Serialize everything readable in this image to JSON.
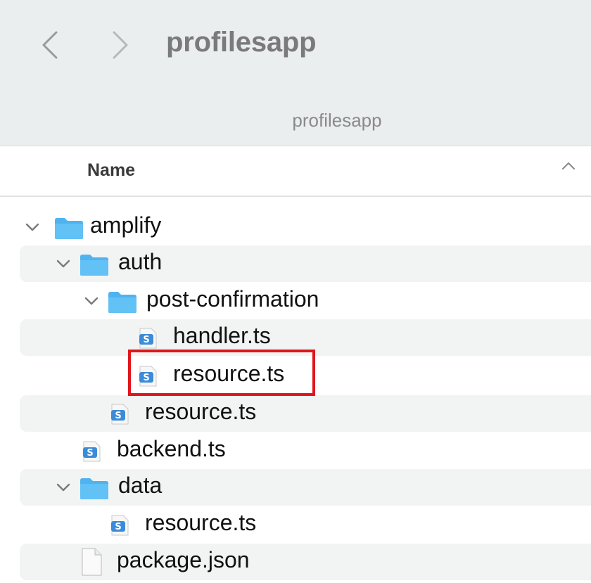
{
  "window": {
    "title": "profilesapp",
    "path_label": "profilesapp"
  },
  "column_header": {
    "name": "Name",
    "sort": "ascending"
  },
  "rows": [
    {
      "label": "amplify",
      "kind": "folder",
      "expanded": true
    },
    {
      "label": "auth",
      "kind": "folder",
      "expanded": true
    },
    {
      "label": "post-confirmation",
      "kind": "folder",
      "expanded": true
    },
    {
      "label": "handler.ts",
      "kind": "typescript-file"
    },
    {
      "label": "resource.ts",
      "kind": "typescript-file",
      "highlighted": true
    },
    {
      "label": "resource.ts",
      "kind": "typescript-file"
    },
    {
      "label": "backend.ts",
      "kind": "typescript-file"
    },
    {
      "label": "data",
      "kind": "folder",
      "expanded": true
    },
    {
      "label": "resource.ts",
      "kind": "typescript-file"
    },
    {
      "label": "package.json",
      "kind": "file"
    }
  ],
  "colors": {
    "folder": "#4fb3ef",
    "highlight_border": "#e0161b",
    "ts_icon": "#3b8bd8"
  }
}
